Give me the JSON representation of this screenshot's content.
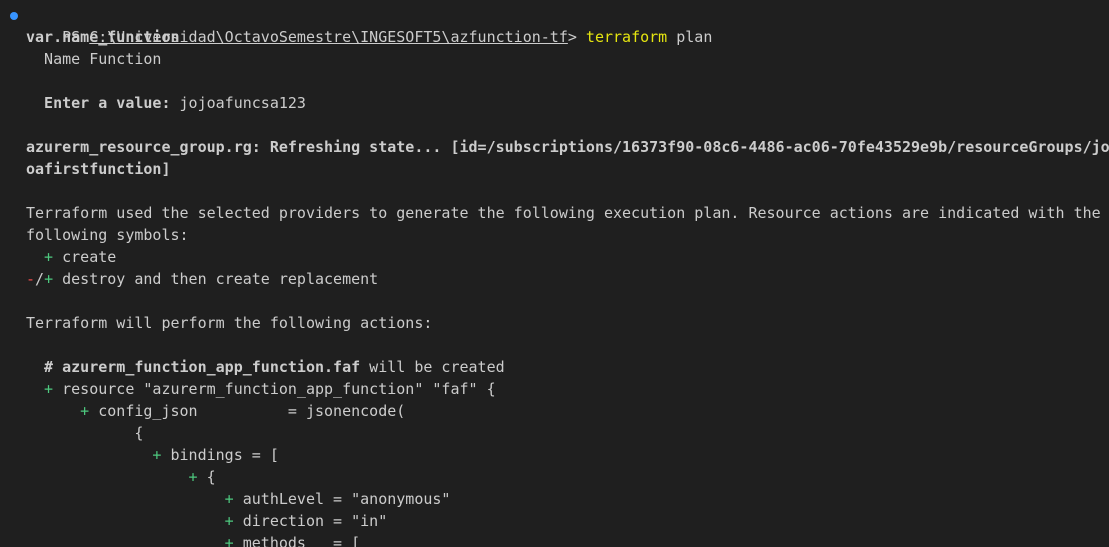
{
  "prompt": {
    "ps": "PS ",
    "path": "C:\\Universidad\\OctavoSemestre\\INGESOFT5\\azfunction-tf",
    "gt": "> ",
    "command": "terraform",
    "args": " plan"
  },
  "var_block": {
    "name": "var.name_function",
    "description": "  Name Function",
    "enter_label": "  Enter a value:",
    "entered_value": " jojoafuncsa123"
  },
  "refresh": {
    "resource": "azurerm_resource_group.rg: Refreshing state... [id=/subscriptions/16373f90-08c6-4486-ac06-70fe43529e9b/resourceGroups/jo",
    "continuation": "oafirstfunction]"
  },
  "plan_intro": {
    "line1": "Terraform used the selected providers to generate the following execution plan. Resource actions are indicated with the",
    "line2": "following symbols:",
    "create_symbol": "  + ",
    "create_text": "create",
    "replace_symbol_minus": "-",
    "replace_symbol_slash": "/",
    "replace_symbol_plus": "+",
    "replace_text": " destroy and then create replacement"
  },
  "actions_header": "Terraform will perform the following actions:",
  "plan_body": {
    "comment_hash": "  # ",
    "comment_resource": "azurerm_function_app_function.faf",
    "comment_suffix": " will be created",
    "resource_plus": "  + ",
    "resource_text": "resource \"azurerm_function_app_function\" \"faf\" {",
    "config_plus": "      + ",
    "config_text": "config_json          = jsonencode(",
    "open_brace": "            {",
    "bindings_plus": "              + ",
    "bindings_text": "bindings = [",
    "item_plus": "                  + ",
    "item_text": "{",
    "auth_plus": "                      + ",
    "auth_text": "authLevel = \"anonymous\"",
    "dir_plus": "                      + ",
    "dir_text": "direction = \"in\"",
    "methods_plus": "                      + ",
    "methods_text": "methods   = ["
  }
}
